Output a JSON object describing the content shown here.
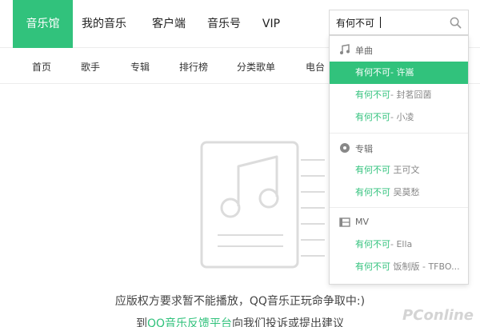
{
  "nav": {
    "items": [
      {
        "label": "音乐馆",
        "active": true
      },
      {
        "label": "我的音乐",
        "active": false
      },
      {
        "label": "客户端",
        "active": false
      },
      {
        "label": "音乐号",
        "active": false
      },
      {
        "label": "VIP",
        "active": false
      }
    ]
  },
  "search": {
    "value": "有何不可",
    "icon": "search-icon"
  },
  "subnav": {
    "items": [
      "首页",
      "歌手",
      "专辑",
      "排行榜",
      "分类歌单",
      "电台"
    ]
  },
  "dropdown": {
    "groups": [
      {
        "title": "单曲",
        "icon": "music-note-icon",
        "items": [
          {
            "keyword": "有何不可",
            "rest": "- 许嵩",
            "highlighted": true
          },
          {
            "keyword": "有何不可",
            "rest": "- 封茗囧菌",
            "highlighted": false
          },
          {
            "keyword": "有何不可",
            "rest": "- 小凌",
            "highlighted": false
          }
        ]
      },
      {
        "title": "专辑",
        "icon": "album-disc-icon",
        "items": [
          {
            "keyword": "有何不可",
            "rest": " 王可文",
            "highlighted": false
          },
          {
            "keyword": "有何不可",
            "rest": " 吴莫愁",
            "highlighted": false
          }
        ]
      },
      {
        "title": "MV",
        "icon": "film-icon",
        "items": [
          {
            "keyword": "有何不可",
            "rest": "- Ella",
            "highlighted": false
          },
          {
            "keyword": "有何不可",
            "rest": " 饭制版 - TFBO...",
            "highlighted": false
          }
        ]
      }
    ]
  },
  "empty": {
    "message": "应版权方要求暂不能播放，QQ音乐正玩命争取中:)",
    "feedback_prefix": "到",
    "feedback_link": "QQ音乐反馈平台",
    "feedback_suffix": "向我们投诉或提出建议"
  },
  "watermark": "PConline",
  "colors": {
    "accent": "#31c27c",
    "text": "#333333",
    "muted": "#888888"
  }
}
